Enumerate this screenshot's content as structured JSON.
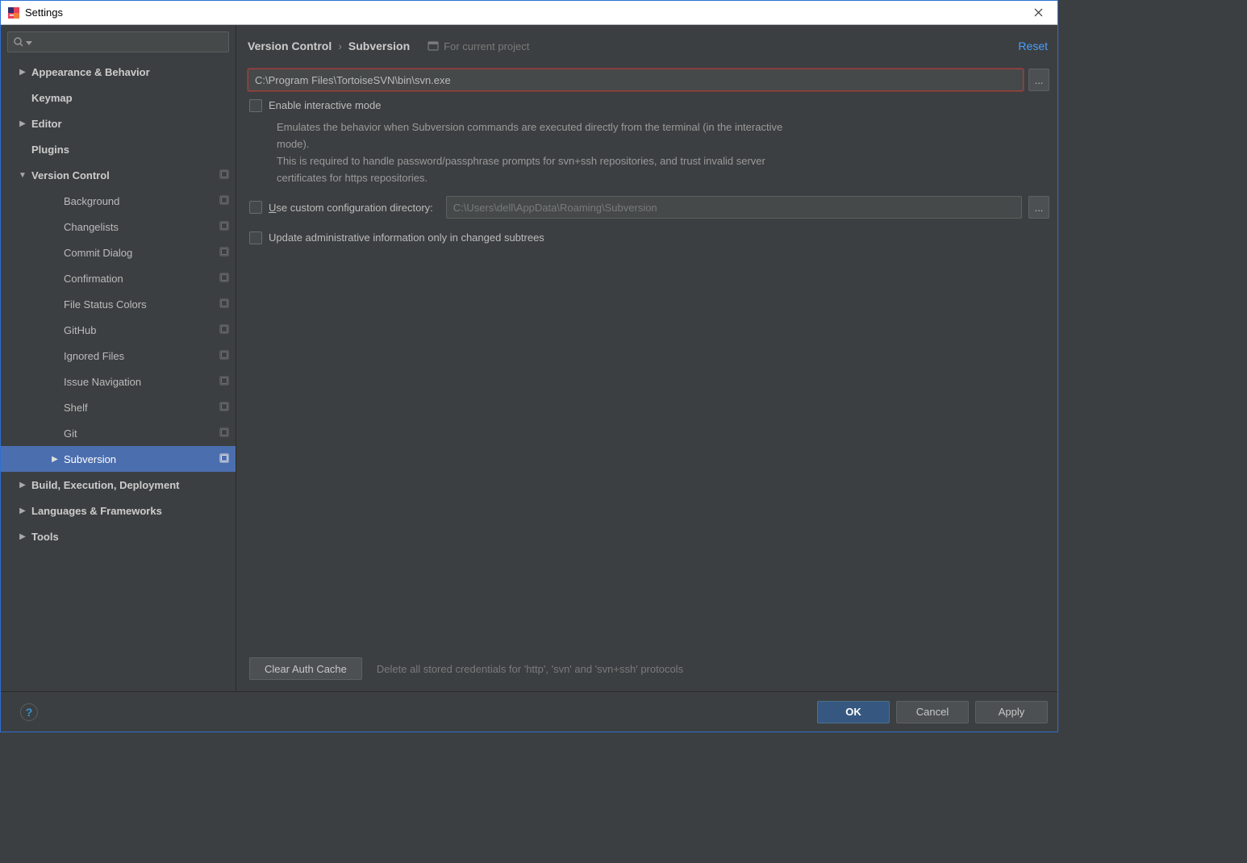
{
  "window": {
    "title": "Settings"
  },
  "sidebar": {
    "search_placeholder": "",
    "items": [
      {
        "label": "Appearance & Behavior",
        "level": 0,
        "arrow": "right",
        "bold": true,
        "proj": false
      },
      {
        "label": "Keymap",
        "level": 0,
        "arrow": "none",
        "bold": true,
        "proj": false
      },
      {
        "label": "Editor",
        "level": 0,
        "arrow": "right",
        "bold": true,
        "proj": false
      },
      {
        "label": "Plugins",
        "level": 0,
        "arrow": "none",
        "bold": true,
        "proj": false
      },
      {
        "label": "Version Control",
        "level": 0,
        "arrow": "down",
        "bold": true,
        "proj": true
      },
      {
        "label": "Background",
        "level": 1,
        "arrow": "none",
        "bold": false,
        "proj": true
      },
      {
        "label": "Changelists",
        "level": 1,
        "arrow": "none",
        "bold": false,
        "proj": true
      },
      {
        "label": "Commit Dialog",
        "level": 1,
        "arrow": "none",
        "bold": false,
        "proj": true
      },
      {
        "label": "Confirmation",
        "level": 1,
        "arrow": "none",
        "bold": false,
        "proj": true
      },
      {
        "label": "File Status Colors",
        "level": 1,
        "arrow": "none",
        "bold": false,
        "proj": true
      },
      {
        "label": "GitHub",
        "level": 1,
        "arrow": "none",
        "bold": false,
        "proj": true
      },
      {
        "label": "Ignored Files",
        "level": 1,
        "arrow": "none",
        "bold": false,
        "proj": true
      },
      {
        "label": "Issue Navigation",
        "level": 1,
        "arrow": "none",
        "bold": false,
        "proj": true
      },
      {
        "label": "Shelf",
        "level": 1,
        "arrow": "none",
        "bold": false,
        "proj": true
      },
      {
        "label": "Git",
        "level": 1,
        "arrow": "none",
        "bold": false,
        "proj": true
      },
      {
        "label": "Subversion",
        "level": 1,
        "arrow": "right",
        "bold": false,
        "proj": true,
        "selected": true
      },
      {
        "label": "Build, Execution, Deployment",
        "level": 0,
        "arrow": "right",
        "bold": true,
        "proj": false
      },
      {
        "label": "Languages & Frameworks",
        "level": 0,
        "arrow": "right",
        "bold": true,
        "proj": false
      },
      {
        "label": "Tools",
        "level": 0,
        "arrow": "right",
        "bold": true,
        "proj": false
      }
    ]
  },
  "breadcrumb": {
    "parent": "Version Control",
    "current": "Subversion",
    "scope": "For current project",
    "reset": "Reset"
  },
  "form": {
    "svn_path": "C:\\Program Files\\TortoiseSVN\\bin\\svn.exe",
    "browse": "...",
    "interactive_label": "Enable interactive mode",
    "interactive_help": "Emulates the behavior when Subversion commands are executed directly from the terminal (in the interactive mode).\nThis is required to handle password/passphrase prompts for svn+ssh repositories, and trust invalid server certificates for https repositories.",
    "custom_config_label": "Use custom configuration directory:",
    "custom_config_value": "C:\\Users\\dell\\AppData\\Roaming\\Subversion",
    "update_admin_label": "Update administrative information only in changed subtrees",
    "clear_cache_btn": "Clear Auth Cache",
    "clear_cache_help": "Delete all stored credentials for 'http', 'svn' and 'svn+ssh' protocols"
  },
  "buttons": {
    "ok": "OK",
    "cancel": "Cancel",
    "apply": "Apply"
  }
}
